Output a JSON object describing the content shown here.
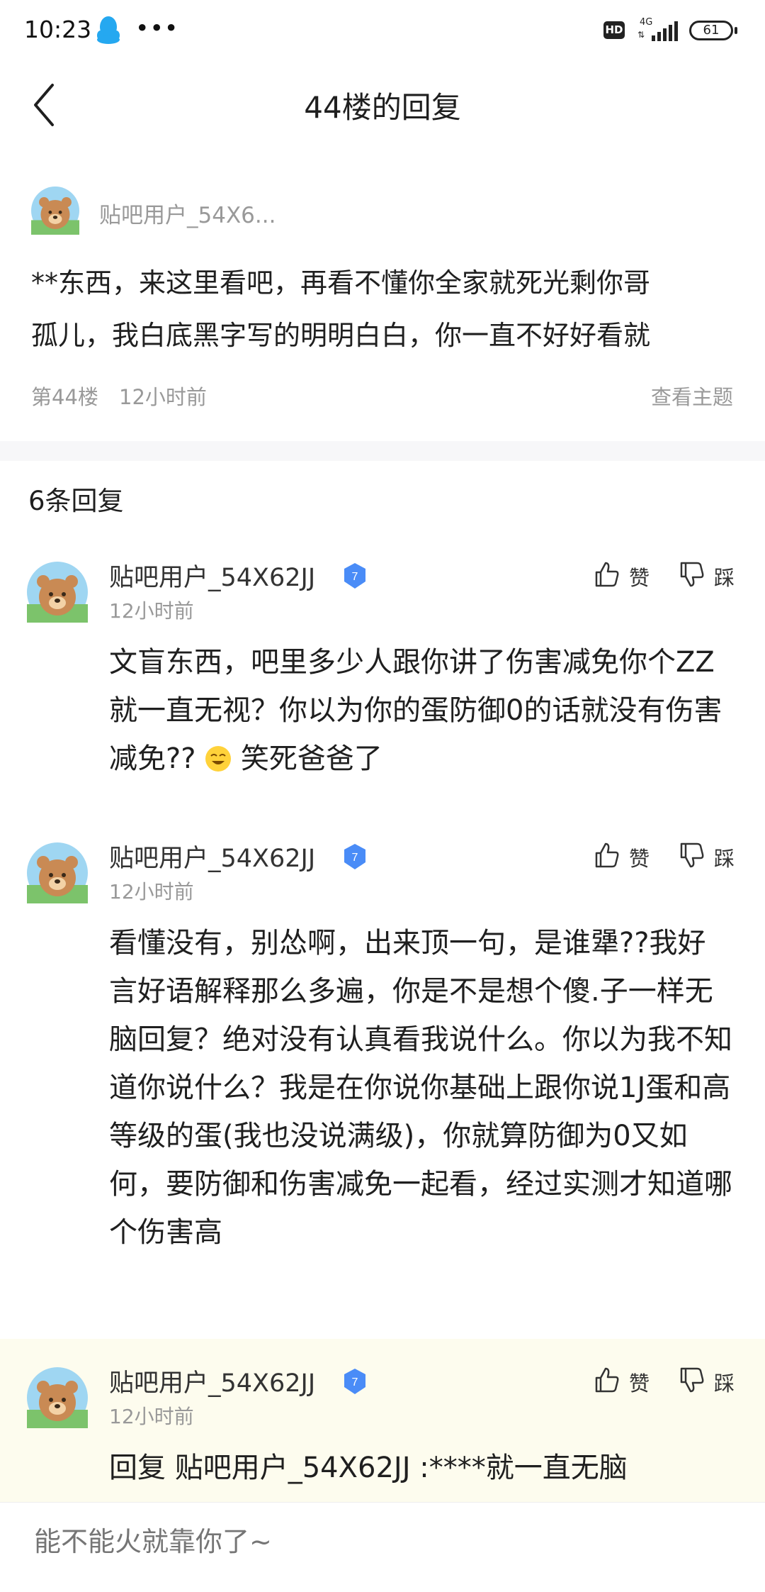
{
  "status_bar": {
    "time": "10:23",
    "more": "•••",
    "hd": "HD",
    "network": "4G",
    "battery": "61"
  },
  "header": {
    "title": "44楼的回复"
  },
  "original_post": {
    "username": "贴吧用户_54X6...",
    "content_line1": "**东西，来这里看吧，再看不懂你全家就死光剩你哥",
    "content_line2": "孤儿，我白底黑字写的明明白白，你一直不好好看就",
    "floor": "第44楼",
    "time": "12小时前",
    "view_topic": "查看主题"
  },
  "reply_count": "6条回复",
  "replies": [
    {
      "username": "贴吧用户_54X62JJ",
      "level": "7",
      "time": "12小时前",
      "like_label": "赞",
      "dislike_label": "踩",
      "content": "文盲东西，吧里多少人跟你讲了伤害减免你个ZZ就一直无视？你以为你的蛋防御0的话就没有伤害减免??",
      "content_after_emoji": "笑死爸爸了"
    },
    {
      "username": "贴吧用户_54X62JJ",
      "level": "7",
      "time": "12小时前",
      "like_label": "赞",
      "dislike_label": "踩",
      "content": "看懂没有，别怂啊，出来顶一句，是谁犟??我好言好语解释那么多遍，你是不是想个傻.子一样无脑回复？绝对没有认真看我说什么。你以为我不知道你说什么？我是在你说你基础上跟你说1J蛋和高等级的蛋(我也没说满级)，你就算防御为0又如何，要防御和伤害减免一起看，经过实测才知道哪个伤害高"
    },
    {
      "username": "贴吧用户_54X62JJ",
      "level": "7",
      "time": "12小时前",
      "like_label": "赞",
      "dislike_label": "踩",
      "content": "回复 贴吧用户_54X62JJ :****就一直无脑"
    }
  ],
  "input": {
    "placeholder": "能不能火就靠你了~"
  },
  "colors": {
    "highlight_bg": "#fdfcee",
    "badge_blue": "#4a8cf7",
    "secondary_text": "#999999"
  }
}
